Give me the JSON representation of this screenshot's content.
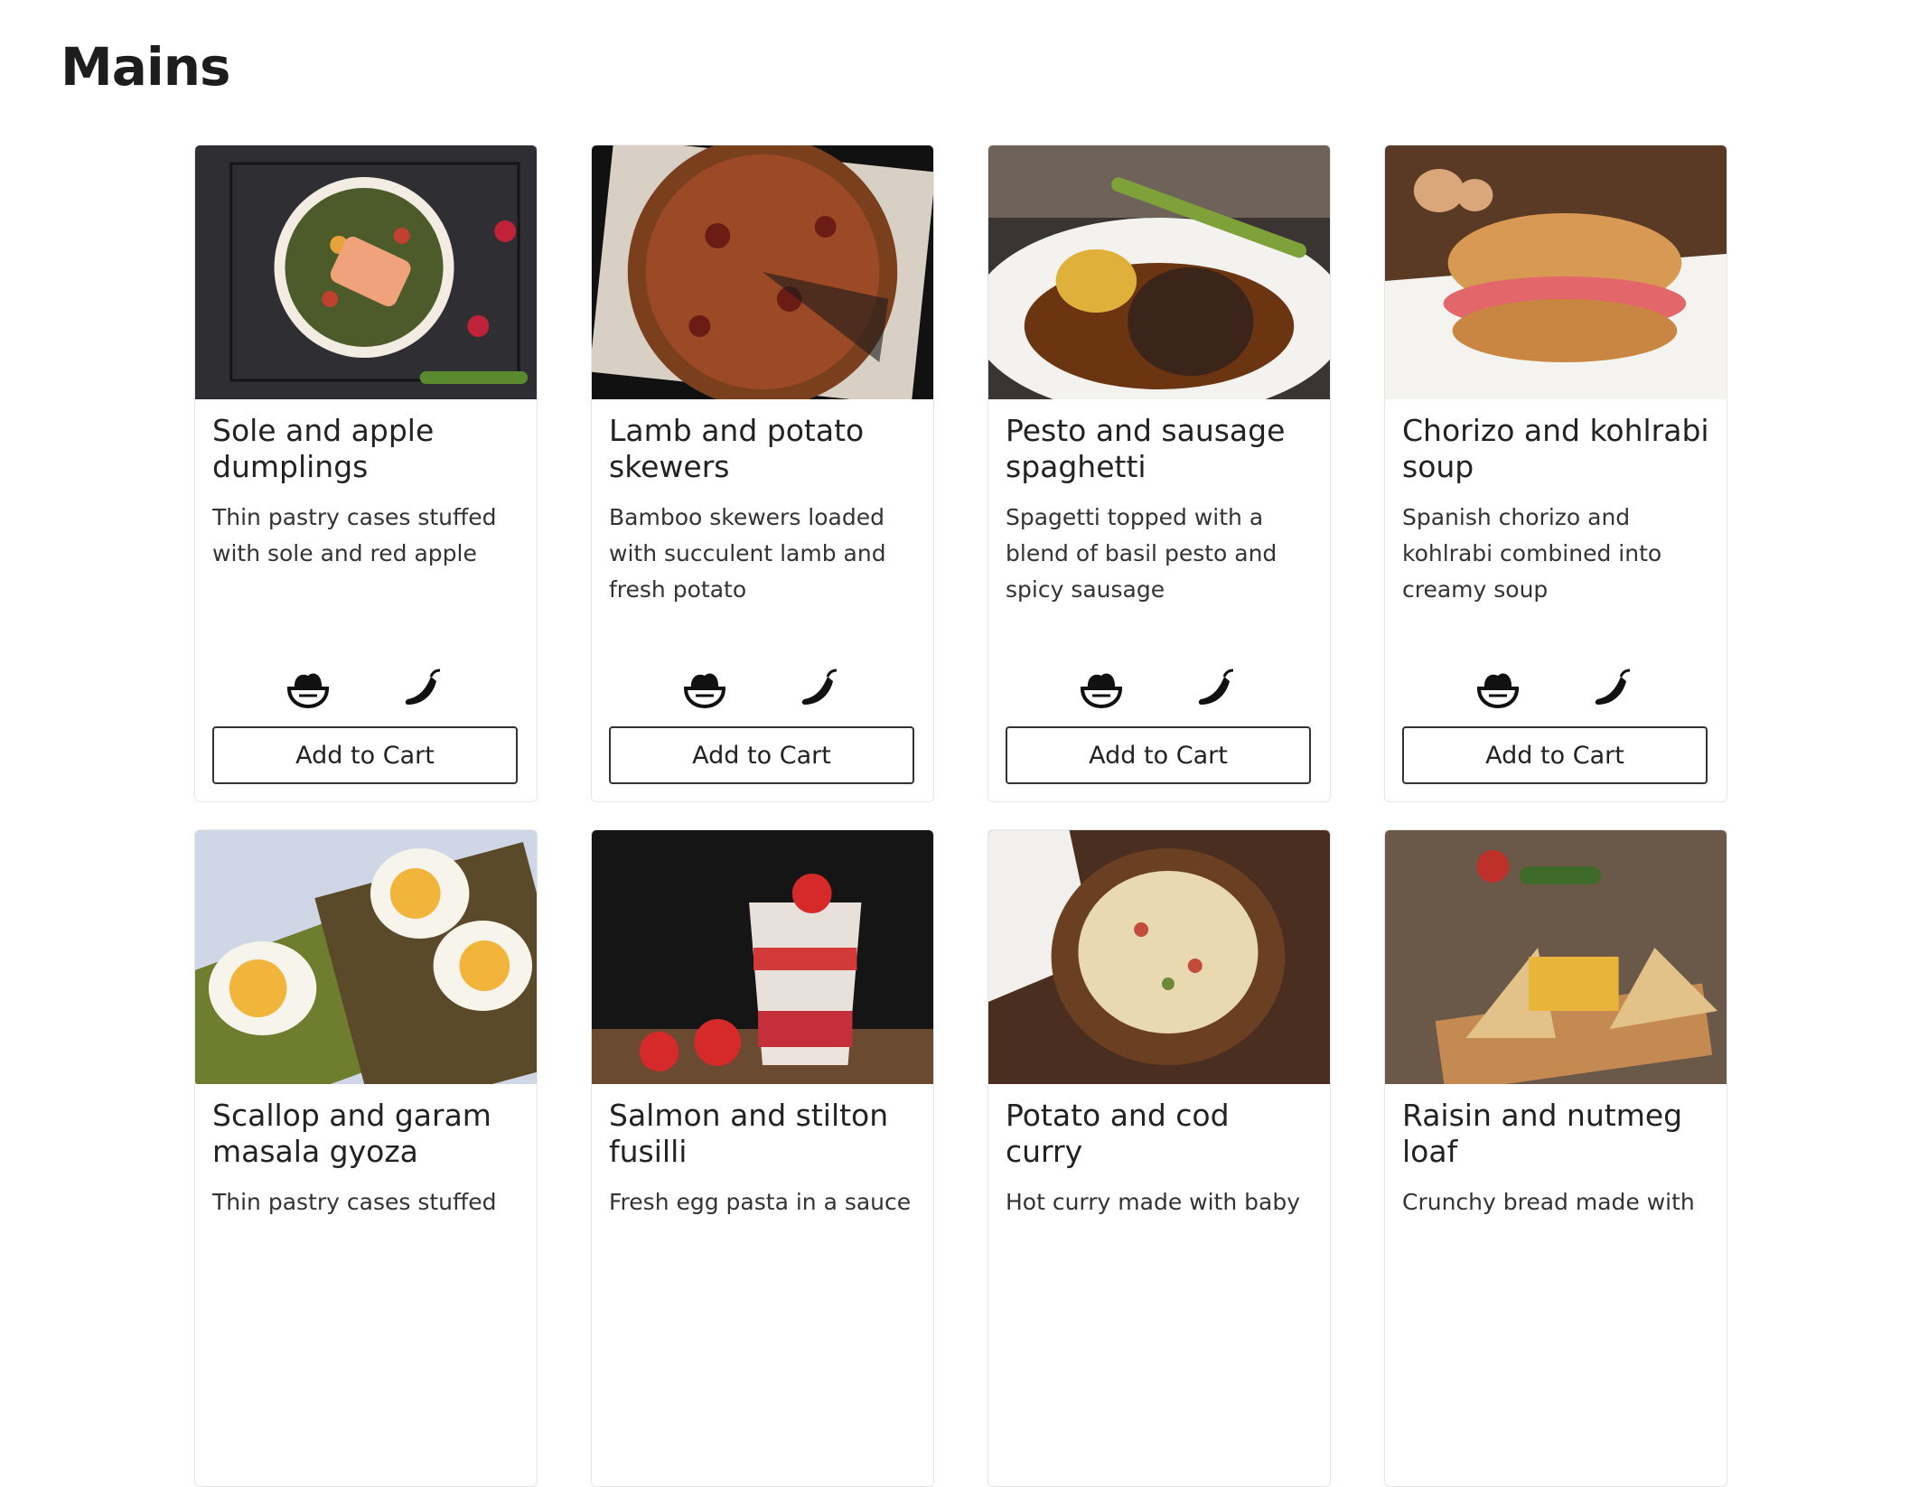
{
  "page": {
    "title": "Mains"
  },
  "cart_label": "Add to Cart",
  "items": [
    {
      "title": "Sole and apple dumplings",
      "description": "Thin pastry cases stuffed with sole and red apple",
      "image": "salmon-bowl-photo",
      "icons": [
        "salad-bowl-icon",
        "chili-pepper-icon"
      ]
    },
    {
      "title": "Lamb and potato skewers",
      "description": "Bamboo skewers loaded with succulent lamb and fresh potato",
      "image": "pizza-photo",
      "icons": [
        "salad-bowl-icon",
        "chili-pepper-icon"
      ]
    },
    {
      "title": "Pesto and sausage spaghetti",
      "description": "Spagetti topped with a blend of basil pesto and spicy sausage",
      "image": "steak-plate-photo",
      "icons": [
        "salad-bowl-icon",
        "chili-pepper-icon"
      ]
    },
    {
      "title": "Chorizo and kohlrabi soup",
      "description": "Spanish chorizo and kohlrabi combined into creamy soup",
      "image": "ham-sandwich-photo",
      "icons": [
        "salad-bowl-icon",
        "chili-pepper-icon"
      ]
    },
    {
      "title": "Scallop and garam masala gyoza",
      "description": "Thin pastry cases stuffed",
      "image": "egg-avocado-toast-photo"
    },
    {
      "title": "Salmon and stilton fusilli",
      "description": "Fresh egg pasta in a sauce",
      "image": "strawberry-parfait-photo"
    },
    {
      "title": "Potato and cod curry",
      "description": "Hot curry made with baby",
      "image": "penne-bowl-photo"
    },
    {
      "title": "Raisin and nutmeg loaf",
      "description": "Crunchy bread made with",
      "image": "club-sandwich-photo"
    }
  ]
}
